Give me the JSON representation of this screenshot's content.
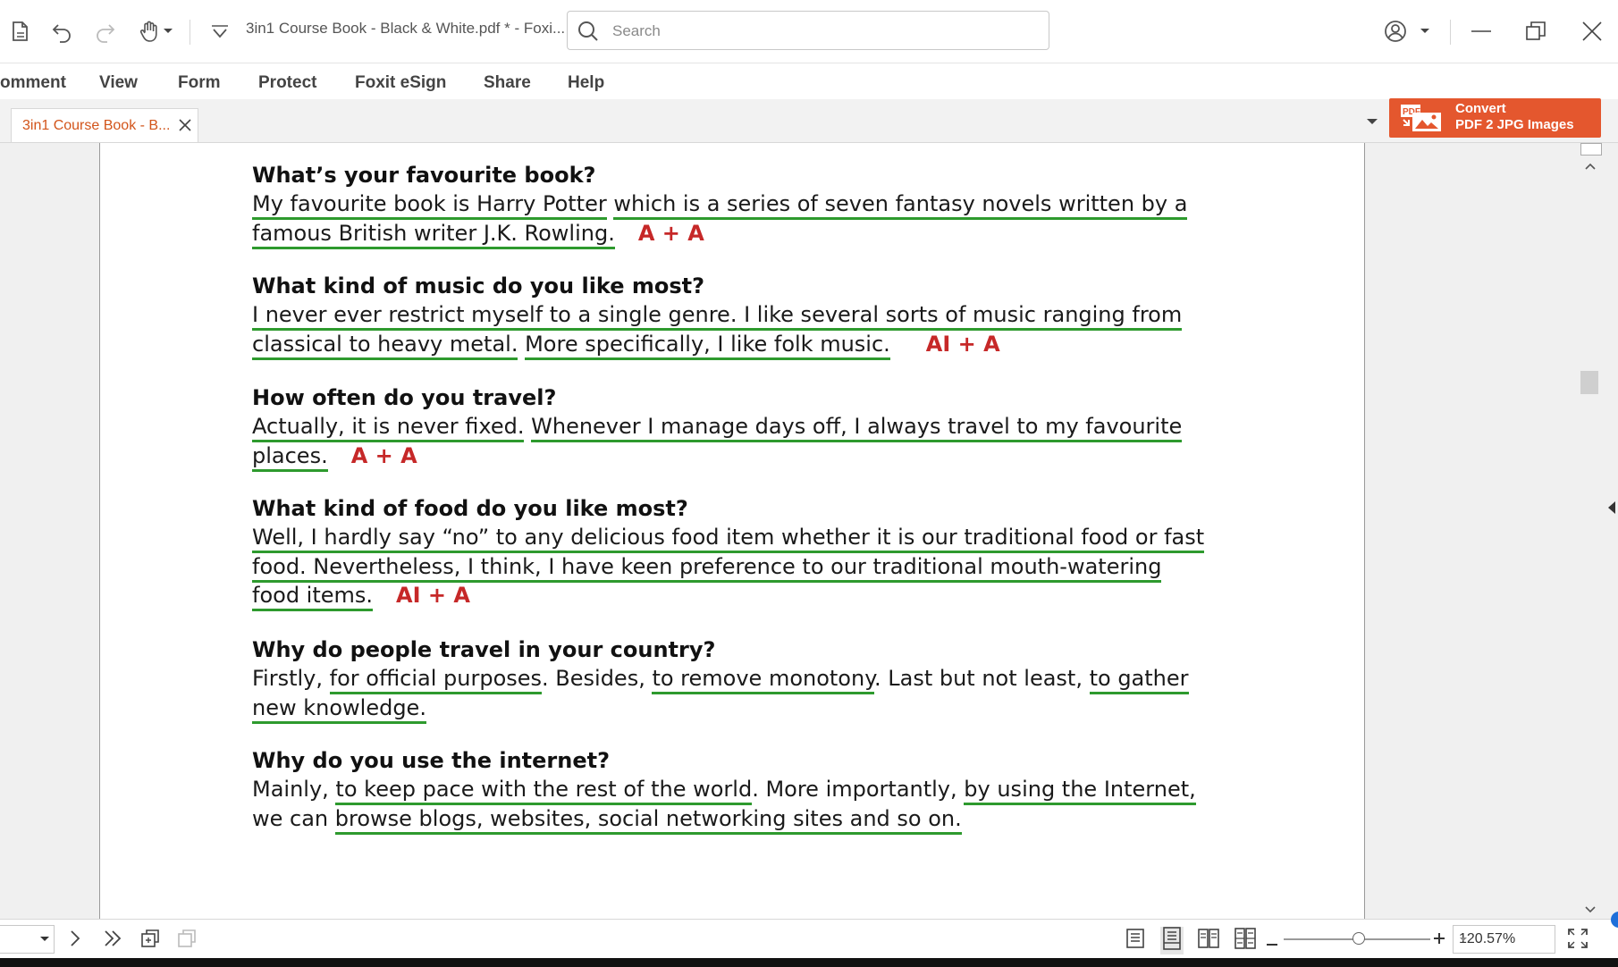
{
  "window": {
    "title": "3in1 Course Book - Black & White.pdf * - Foxi..."
  },
  "search": {
    "placeholder": "Search"
  },
  "menu": {
    "items": [
      "omment",
      "View",
      "Form",
      "Protect",
      "Foxit eSign",
      "Share",
      "Help"
    ]
  },
  "tab": {
    "label": "3in1 Course Book - B..."
  },
  "convert": {
    "line1": "Convert",
    "line2": "PDF 2 JPG Images"
  },
  "document": {
    "qa": [
      {
        "question": "What’s your favourite book?",
        "answer_lines": [
          [
            "My favourite book is Harry Potter",
            " ",
            "which is a series of seven fantasy novels written by a"
          ],
          [
            "famous British writer J.K. Rowling."
          ]
        ],
        "grade": "A + A"
      },
      {
        "question": "What kind of music do you like most?",
        "answer_lines": [
          [
            "I never ever restrict myself to a single genre. I like several sorts of music ranging from"
          ],
          [
            "classical to heavy metal.",
            " ",
            "More specifically, I like folk music."
          ]
        ],
        "grade": "AI + A"
      },
      {
        "question": "How often do you travel?",
        "answer_lines": [
          [
            "Actually, it is never fixed.",
            " ",
            "Whenever I manage days off, I always travel to my favourite"
          ],
          [
            "places."
          ]
        ],
        "grade": "A + A"
      },
      {
        "question": "What kind of food do you like most?",
        "answer_lines": [
          [
            "Well, I hardly say “no” to any delicious food item whether it is our traditional food or fast"
          ],
          [
            "food. Nevertheless, I think, I have keen preference to our traditional mouth-watering"
          ],
          [
            "food items."
          ]
        ],
        "grade": "AI + A"
      },
      {
        "question": "Why do people travel in your country?",
        "answer_lines": [
          [
            "Firstly, ",
            "for official purposes",
            ". Besides, ",
            "to remove monotony",
            ". Last but not least, ",
            "to gather"
          ],
          [
            "new knowledge."
          ]
        ],
        "grade": ""
      },
      {
        "question": "Why do you use the internet?",
        "answer_lines": [
          [
            "Mainly, ",
            "to keep pace with the rest of the world",
            ". More importantly, ",
            "by using the Internet,"
          ],
          [
            "we can ",
            "browse blogs, websites, social networking sites and so on."
          ]
        ],
        "grade": ""
      }
    ]
  },
  "status": {
    "zoom": "120.57%"
  },
  "icons": {
    "accent": "#e4572e",
    "underline": "#2e9a2e",
    "grade": "#c62828",
    "tab_text": "#d2541a"
  }
}
